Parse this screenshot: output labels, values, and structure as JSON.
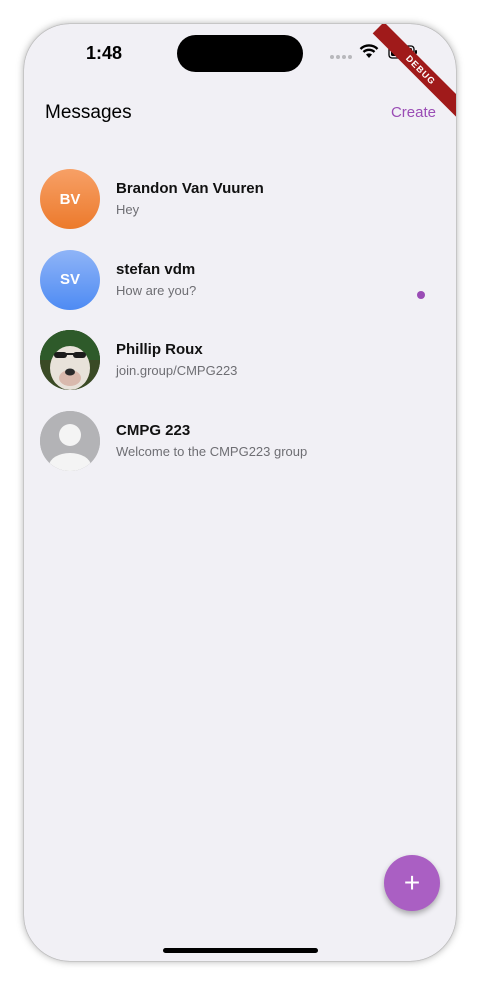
{
  "status_bar": {
    "time": "1:48"
  },
  "debug_banner": "DEBUG",
  "nav": {
    "title": "Messages",
    "create_label": "Create"
  },
  "conversations": [
    {
      "initials": "BV",
      "name": "Brandon Van Vuuren",
      "message": "Hey",
      "avatar_color": "#ef8a3f"
    },
    {
      "initials": "SV",
      "name": "stefan vdm",
      "message": "How are you?",
      "avatar_color": "#6a9df5"
    },
    {
      "initials": "",
      "name": "Phillip Roux",
      "message": "join.group/CMPG223",
      "avatar_icon": "photo-avatar"
    },
    {
      "initials": "",
      "name": "CMPG 223",
      "message": "Welcome to the CMPG223 group",
      "avatar_icon": "default-person-icon",
      "unread": true
    }
  ],
  "fab": {
    "label": "+"
  },
  "colors": {
    "accent": "#9a4cb5",
    "background": "#f1f0f5"
  }
}
